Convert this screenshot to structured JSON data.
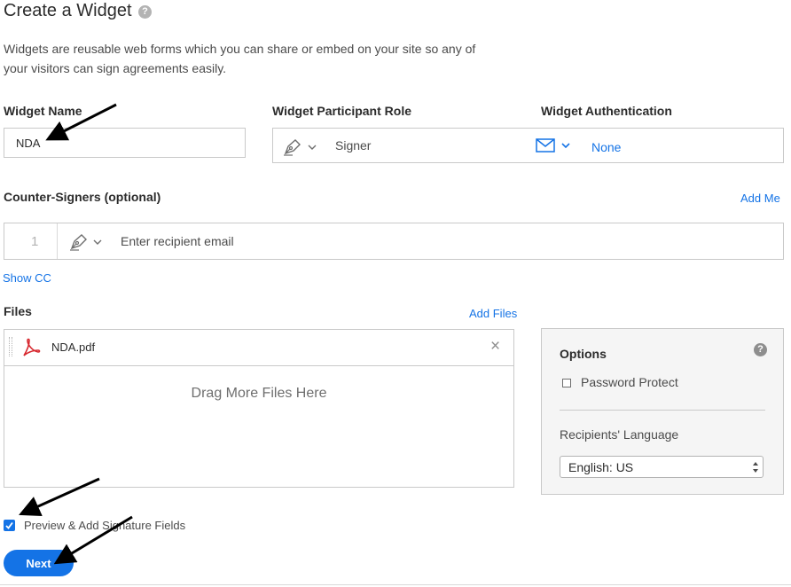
{
  "header": {
    "title": "Create a Widget",
    "help_glyph": "?",
    "description_line1": "Widgets are reusable web forms which you can share or embed on your site so any of",
    "description_line2": "your visitors can sign agreements easily."
  },
  "widget_name": {
    "label": "Widget Name",
    "value": "NDA"
  },
  "participant_role": {
    "label": "Widget Participant Role",
    "value": "Signer",
    "icon": "pen-icon"
  },
  "authentication": {
    "label": "Widget Authentication",
    "value": "None",
    "icon": "envelope-icon"
  },
  "counter_signers": {
    "label": "Counter-Signers (optional)",
    "add_me": "Add Me",
    "row_number": "1",
    "email_placeholder": "Enter recipient email",
    "show_cc": "Show CC"
  },
  "files": {
    "label": "Files",
    "add_files": "Add Files",
    "items": [
      {
        "name": "NDA.pdf",
        "icon": "pdf-icon"
      }
    ],
    "remove_glyph": "×",
    "drop_text": "Drag More Files Here"
  },
  "options": {
    "title": "Options",
    "help_glyph": "?",
    "password_protect": {
      "label": "Password Protect",
      "checked": false
    },
    "language_label": "Recipients' Language",
    "language_value": "English: US"
  },
  "preview": {
    "label": "Preview & Add Signature Fields",
    "checked": true
  },
  "next_button": "Next",
  "colors": {
    "accent": "#1473e6",
    "pdf_red": "#d7282f",
    "border": "#c9c9c9"
  }
}
